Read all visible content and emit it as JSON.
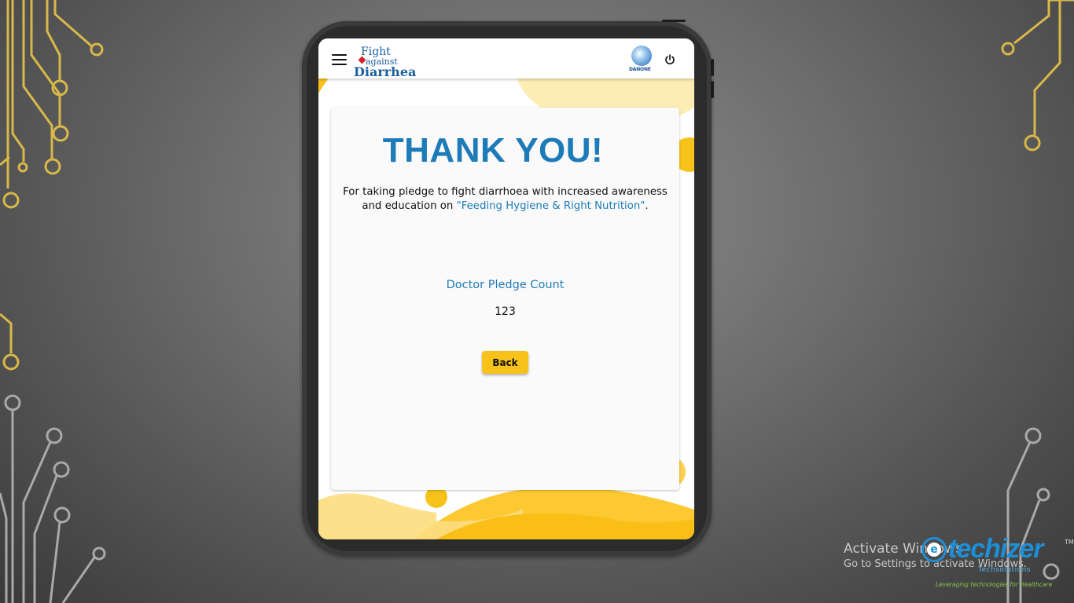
{
  "app": {
    "logo_lines": [
      "Fight",
      "against",
      "Diarrhea"
    ],
    "partner_logo_text": "DANONE",
    "menu_icon": "hamburger-menu-icon",
    "power_icon": "power-icon"
  },
  "card": {
    "title": "THANK YOU!",
    "message_prefix": "For taking pledge to fight diarrhoea with increased awareness and education on ",
    "message_highlight": "\"Feeding Hygiene & Right Nutrition\"",
    "message_suffix": ".",
    "count_label": "Doctor Pledge Count",
    "count_value": "123",
    "back_label": "Back"
  },
  "watermark": {
    "line1": "Activate Windows",
    "line2": "Go to Settings to activate Windows."
  },
  "brand": {
    "name": "techizer",
    "trademark": "TM",
    "sub": "Techsolutions",
    "tagline": "Leveraging technologies for Healthcare",
    "icon_letter": "e"
  },
  "colors": {
    "accent_blue": "#1d7bb8",
    "accent_yellow": "#f7c21a",
    "circuit_gold": "#d9b84a"
  }
}
